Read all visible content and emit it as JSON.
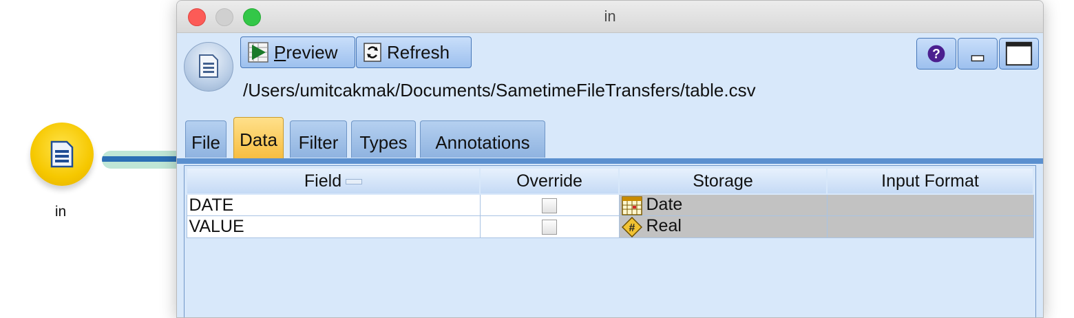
{
  "canvas": {
    "node_label": "in"
  },
  "window": {
    "title": "in",
    "toolbar": {
      "preview_label_u": "P",
      "preview_label_rest": "review",
      "refresh_label": "Refresh"
    },
    "file_path": "/Users/umitcakmak/Documents/SametimeFileTransfers/table.csv",
    "tabs": [
      {
        "label": "File"
      },
      {
        "label": "Data"
      },
      {
        "label": "Filter"
      },
      {
        "label": "Types"
      },
      {
        "label": "Annotations"
      }
    ],
    "active_tab": "Data",
    "table": {
      "columns": [
        "Field",
        "Override",
        "Storage",
        "Input Format"
      ],
      "rows": [
        {
          "field": "DATE",
          "override": false,
          "storage": "Date",
          "storage_icon": "calendar-icon",
          "input_format": ""
        },
        {
          "field": "VALUE",
          "override": false,
          "storage": "Real",
          "storage_icon": "real-number-icon",
          "input_format": ""
        }
      ]
    }
  },
  "colors": {
    "window_bg": "#d8e8fa",
    "active_tab": "#f6bb3d",
    "node_fill": "#f6c800",
    "accent": "#2b6fb5"
  }
}
